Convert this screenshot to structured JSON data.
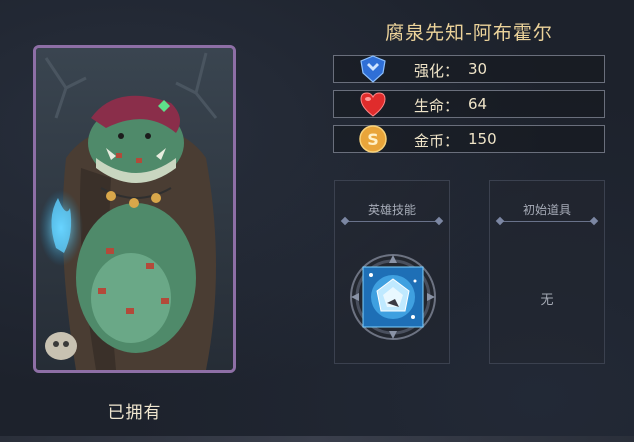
{
  "hero": {
    "name": "腐泉先知-阿布霍尔",
    "status": "已拥有"
  },
  "stats": [
    {
      "icon": "shield-icon",
      "label": "强化：",
      "value": "30"
    },
    {
      "icon": "heart-icon",
      "label": "生命：",
      "value": "64"
    },
    {
      "icon": "coin-icon",
      "label": "金币：",
      "value": "150"
    }
  ],
  "skill_box": {
    "title": "英雄技能",
    "skill_icon": "crystal-skill-icon"
  },
  "item_box": {
    "title": "初始道具",
    "empty_text": "无"
  },
  "colors": {
    "accent_gold": "#ecd39a",
    "card_border": "#8e6fa6",
    "background": "#1d222c"
  }
}
